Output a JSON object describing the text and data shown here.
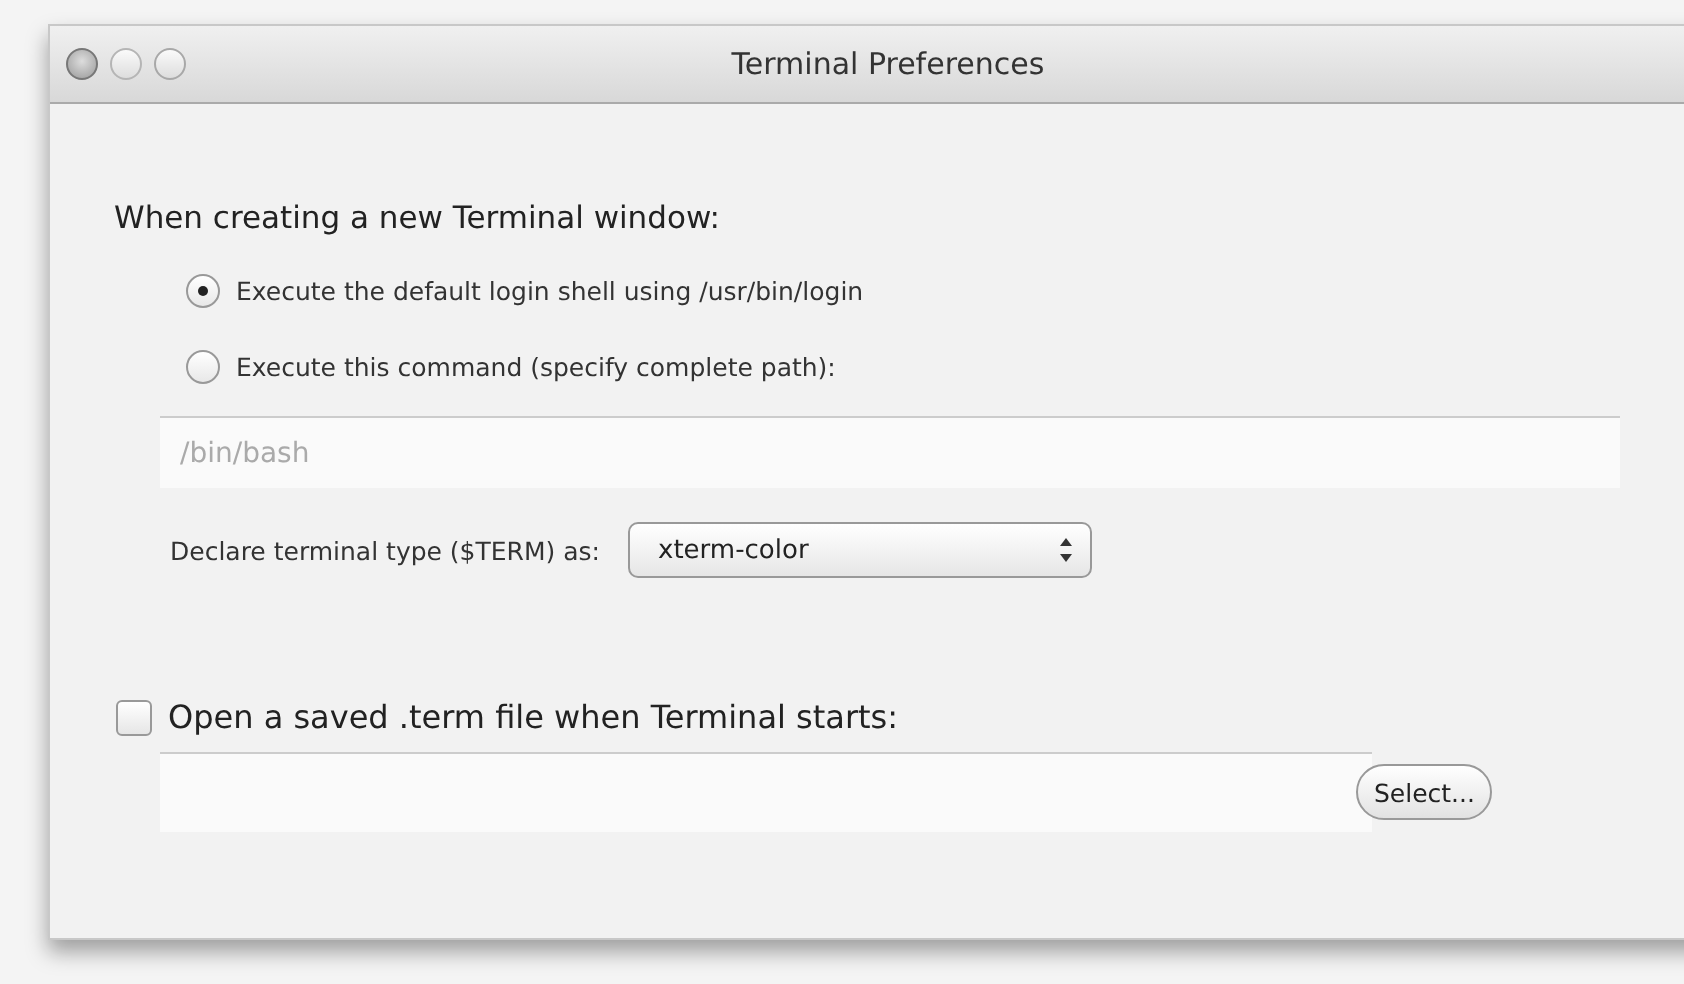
{
  "window": {
    "title": "Terminal Preferences",
    "buttons": [
      {
        "kind": "close",
        "enabled": true
      },
      {
        "kind": "minimize",
        "enabled": false
      },
      {
        "kind": "zoom",
        "enabled": false
      }
    ]
  },
  "startup": {
    "heading": "When creating a new Terminal window:",
    "options": [
      {
        "label": "Execute the default login shell using /usr/bin/login",
        "selected": true
      },
      {
        "label": "Execute this command (specify complete path):",
        "selected": false
      }
    ],
    "command_field": {
      "value": "/bin/bash",
      "disabled": true
    },
    "term_type": {
      "label": "Declare terminal type ($TERM) as:",
      "value": "xterm-color"
    }
  },
  "saved_file": {
    "label": "Open a saved .term file when Terminal starts:",
    "checked": false,
    "button": "Select..."
  }
}
